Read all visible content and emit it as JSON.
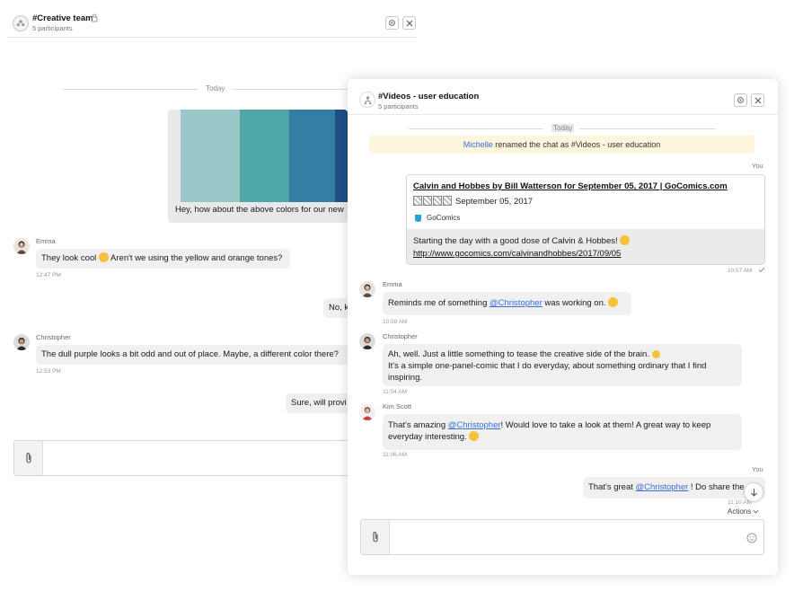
{
  "back_chat": {
    "title": "#Creative team",
    "subtitle": "5 participants",
    "divider_label": "Today",
    "palette_colors": [
      "#9bc6c7",
      "#4ea6a7",
      "#347ea6",
      "#1e4f85"
    ],
    "messages": [
      {
        "text": "Hey, how about the above colors for our new"
      },
      {
        "sender": "Emma",
        "text_before": "They look cool",
        "emoji": "sunglasses-emoji",
        "text_after": "Aren't we using the yellow and orange tones?",
        "time": "12:47 PM"
      },
      {
        "text": "No, k"
      },
      {
        "sender": "Christopher",
        "text": "The dull purple looks a bit odd and out of place. Maybe, a different color there?",
        "time": "12:53 PM"
      },
      {
        "text": "Sure, will provi"
      }
    ],
    "composer": {
      "value": ""
    }
  },
  "front_chat": {
    "title": "#Videos - user education",
    "subtitle": "5 participants",
    "divider_label": "Today",
    "system_message": {
      "actor": "Michelle",
      "text": "renamed the chat as #Videos - user education"
    },
    "you_label": "You",
    "link_card": {
      "title": "Calvin and Hobbes by Bill Watterson for September 05, 2017 | GoComics.com",
      "date": "September 05, 2017",
      "source": "GoComics",
      "text": "Starting the day with a good dose of Calvin & Hobbes!",
      "url": "http://www.gocomics.com/calvinandhobbes/2017/09/05",
      "time": "10:57 AM"
    },
    "messages": [
      {
        "sender": "Emma",
        "text_before": "Reminds me of something",
        "mention": "@Christopher",
        "text_after": "was working on.",
        "time": "10:58 AM"
      },
      {
        "sender": "Christopher",
        "line1": "Ah, well. Just a little something to tease the creative side of the brain.",
        "line2": "It's a simple one-panel-comic that I do everyday, about something ordinary that I find",
        "line3": "inspiring.",
        "time": "11:04 AM"
      },
      {
        "sender": "Kim Scott",
        "text_before": "That's amazing",
        "mention": "@Christopher",
        "text_after": "! Would love to take a look at them! A great way to keep",
        "line2": "everyday interesting.",
        "time": "11:06 AM"
      }
    ],
    "last_message": {
      "text_before": "That's great",
      "mention": "@Christopher",
      "text_after": "! Do share the",
      "time": "11:10 AM"
    },
    "actions_label": "Actions",
    "composer": {
      "value": ""
    },
    "colors": {
      "accent": "#3a6fd8",
      "system_bg": "#fdf5dc",
      "bubble": "#f0f0f0"
    }
  }
}
